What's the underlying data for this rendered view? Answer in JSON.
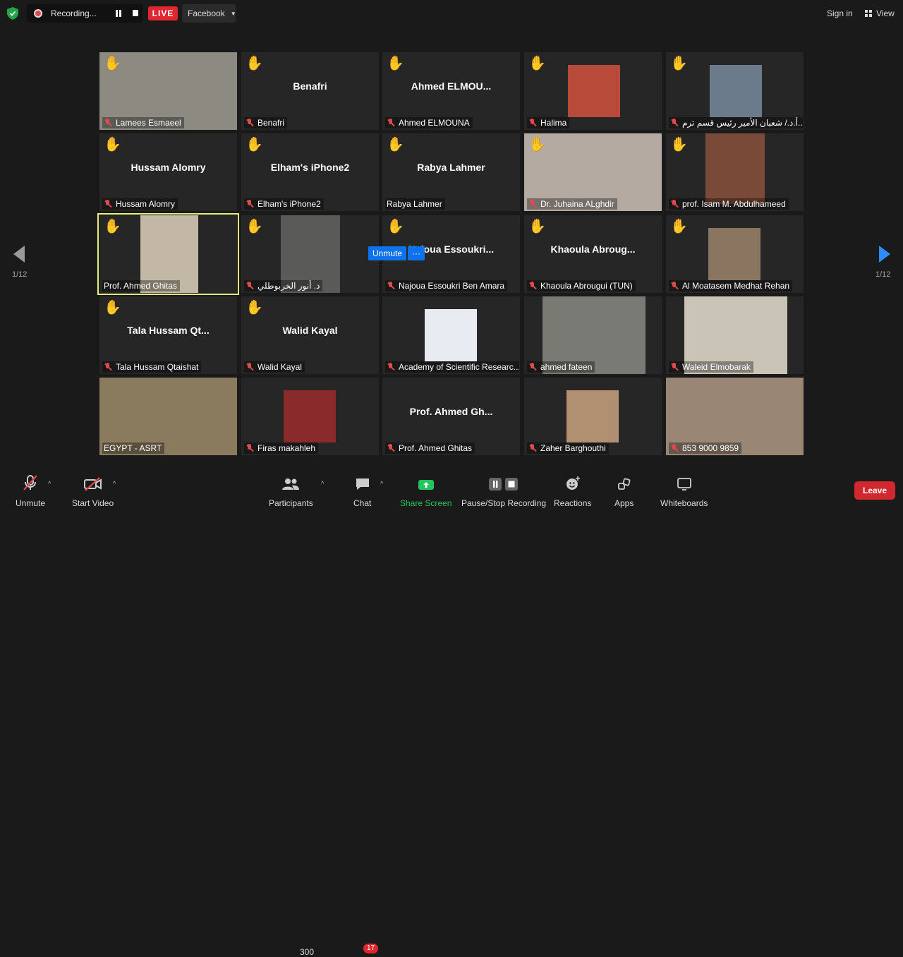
{
  "topbar": {
    "recording_label": "Recording...",
    "live_label": "LIVE",
    "stream_target": "Facebook",
    "sign_in": "Sign in",
    "view": "View"
  },
  "pagination": {
    "left": "1/12",
    "right": "1/12"
  },
  "tiles": [
    {
      "label": "Lamees Esmaeel",
      "center": "",
      "hand": true,
      "muted": true
    },
    {
      "label": "Benafri",
      "center": "Benafri",
      "hand": true,
      "muted": true
    },
    {
      "label": "Ahmed ELMOUNA",
      "center": "Ahmed  ELMOU...",
      "hand": true,
      "muted": true
    },
    {
      "label": "Halima",
      "center": "",
      "hand": true,
      "muted": true
    },
    {
      "label": "أ.د./ شعبان الأمير رئيس قسم ترم...",
      "center": "",
      "hand": true,
      "muted": true
    },
    {
      "label": "Hussam Alomry",
      "center": "Hussam Alomry",
      "hand": true,
      "muted": true
    },
    {
      "label": "Elham's iPhone2",
      "center": "Elham's iPhone2",
      "hand": true,
      "muted": true
    },
    {
      "label": "Rabya Lahmer",
      "center": "Rabya Lahmer",
      "hand": true,
      "muted": false
    },
    {
      "label": "Dr. Juhaina ALghdir",
      "center": "",
      "hand": true,
      "muted": true
    },
    {
      "label": "prof. Isam M. Abdulhameed",
      "center": "",
      "hand": true,
      "muted": true
    },
    {
      "label": "Prof. Ahmed Ghitas",
      "center": "",
      "hand": true,
      "muted": false
    },
    {
      "label": "د. أنور الخربوطلي",
      "center": "",
      "hand": true,
      "muted": true
    },
    {
      "label": "Najoua Essoukri Ben Amara",
      "center": "Najoua  Essoukri...",
      "hand": true,
      "muted": true
    },
    {
      "label": "Khaoula Abrougui (TUN)",
      "center": "Khaoula  Abroug...",
      "hand": true,
      "muted": true
    },
    {
      "label": "Al Moatasem Medhat Rehan",
      "center": "",
      "hand": true,
      "muted": true
    },
    {
      "label": "Tala Hussam Qtaishat",
      "center": "Tala  Hussam  Qt...",
      "hand": true,
      "muted": true
    },
    {
      "label": "Walid Kayal",
      "center": "Walid Kayal",
      "hand": true,
      "muted": true
    },
    {
      "label": "Academy of Scientific Researc...",
      "center": "",
      "hand": false,
      "muted": true
    },
    {
      "label": "ahmed fateen",
      "center": "",
      "hand": false,
      "muted": true
    },
    {
      "label": "Waleid Elmobarak",
      "center": "",
      "hand": false,
      "muted": true
    },
    {
      "label": "EGYPT - ASRT",
      "center": "",
      "hand": false,
      "muted": false
    },
    {
      "label": "Firas makahleh",
      "center": "",
      "hand": false,
      "muted": true
    },
    {
      "label": "Prof. Ahmed Ghitas",
      "center": "Prof.  Ahmed  Gh...",
      "hand": false,
      "muted": true
    },
    {
      "label": "Zaher Barghouthi",
      "center": "",
      "hand": false,
      "muted": true
    },
    {
      "label": "853 9000 9859",
      "center": "",
      "hand": false,
      "muted": true
    }
  ],
  "popover": {
    "unmute": "Unmute",
    "more": "···"
  },
  "toolbar": {
    "unmute": "Unmute",
    "start_video": "Start Video",
    "participants": "Participants",
    "participants_count": "300",
    "chat": "Chat",
    "chat_badge": "17",
    "share_screen": "Share Screen",
    "pause_stop": "Pause/Stop Recording",
    "reactions": "Reactions",
    "apps": "Apps",
    "whiteboards": "Whiteboards",
    "leave": "Leave"
  },
  "colors": {
    "live": "#e0272f",
    "share": "#22c55e",
    "leave": "#d0282e",
    "hand": "#f3c13a",
    "active_border": "#e6f07a",
    "mic_off": "#e04a4a",
    "popover": "#0e72ed"
  }
}
